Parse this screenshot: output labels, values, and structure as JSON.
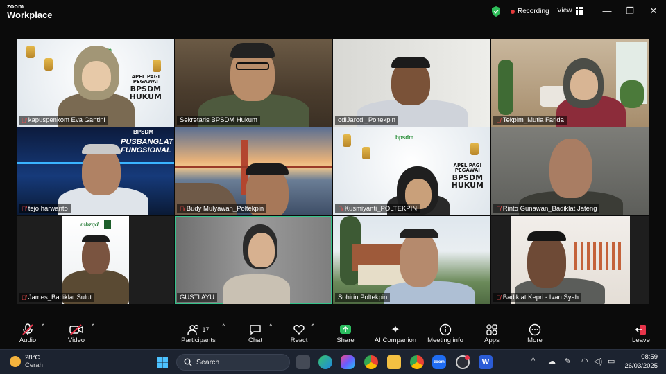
{
  "app": {
    "brand_top": "zoom",
    "brand_bottom": "Workplace",
    "recording_label": "Recording",
    "view_label": "View"
  },
  "participants": [
    {
      "name": "kapuspenkom Eva Gantini",
      "muted": true
    },
    {
      "name": "Sekretaris BPSDM Hukum",
      "muted": false
    },
    {
      "name": "odiJarodi_Poltekpin",
      "muted": false
    },
    {
      "name": "Tekpim_Mutia Farida",
      "muted": true
    },
    {
      "name": "tejo harwanto",
      "muted": true
    },
    {
      "name": "Budy Mulyawan_Poltekpin",
      "muted": true
    },
    {
      "name": "Kusmiyanti_POLTEKPIN",
      "muted": true
    },
    {
      "name": "Rinto Gunawan_Badiklat Jateng",
      "muted": true
    },
    {
      "name": "James_Badiklat Sulut",
      "muted": true
    },
    {
      "name": "GUSTI AYU",
      "muted": false
    },
    {
      "name": "Sohirin Poltekpin",
      "muted": false
    },
    {
      "name": "Badiklat Kepri - Ivan Syah",
      "muted": true
    }
  ],
  "backgrounds": {
    "apel_line1": "APEL PAGI",
    "apel_line2": "PEGAWAI",
    "apel_line3": "BPSDM",
    "apel_line4": "HUKUM",
    "bpsdm_logo": "bpsdm",
    "pusbanglat_1": "PUSBANGLAT",
    "pusbanglat_2": "FUNGSIONAL",
    "bpsdm_small": "BPSDM",
    "mbzqd_logo": "mbzqd"
  },
  "toolbar": {
    "audio": "Audio",
    "video": "Video",
    "participants": "Participants",
    "participants_count": "17",
    "chat": "Chat",
    "react": "React",
    "share": "Share",
    "ai_companion": "AI Companion",
    "meeting_info": "Meeting info",
    "apps": "Apps",
    "more": "More",
    "leave": "Leave"
  },
  "taskbar": {
    "temperature": "28°C",
    "condition": "Cerah",
    "search_placeholder": "Search",
    "time": "08:59",
    "date": "26/03/2025"
  },
  "colors": {
    "active_speaker": "#36c28b",
    "record_dot": "#e23a3a",
    "share_green": "#2bbd5f",
    "leave_red": "#e8344a"
  }
}
